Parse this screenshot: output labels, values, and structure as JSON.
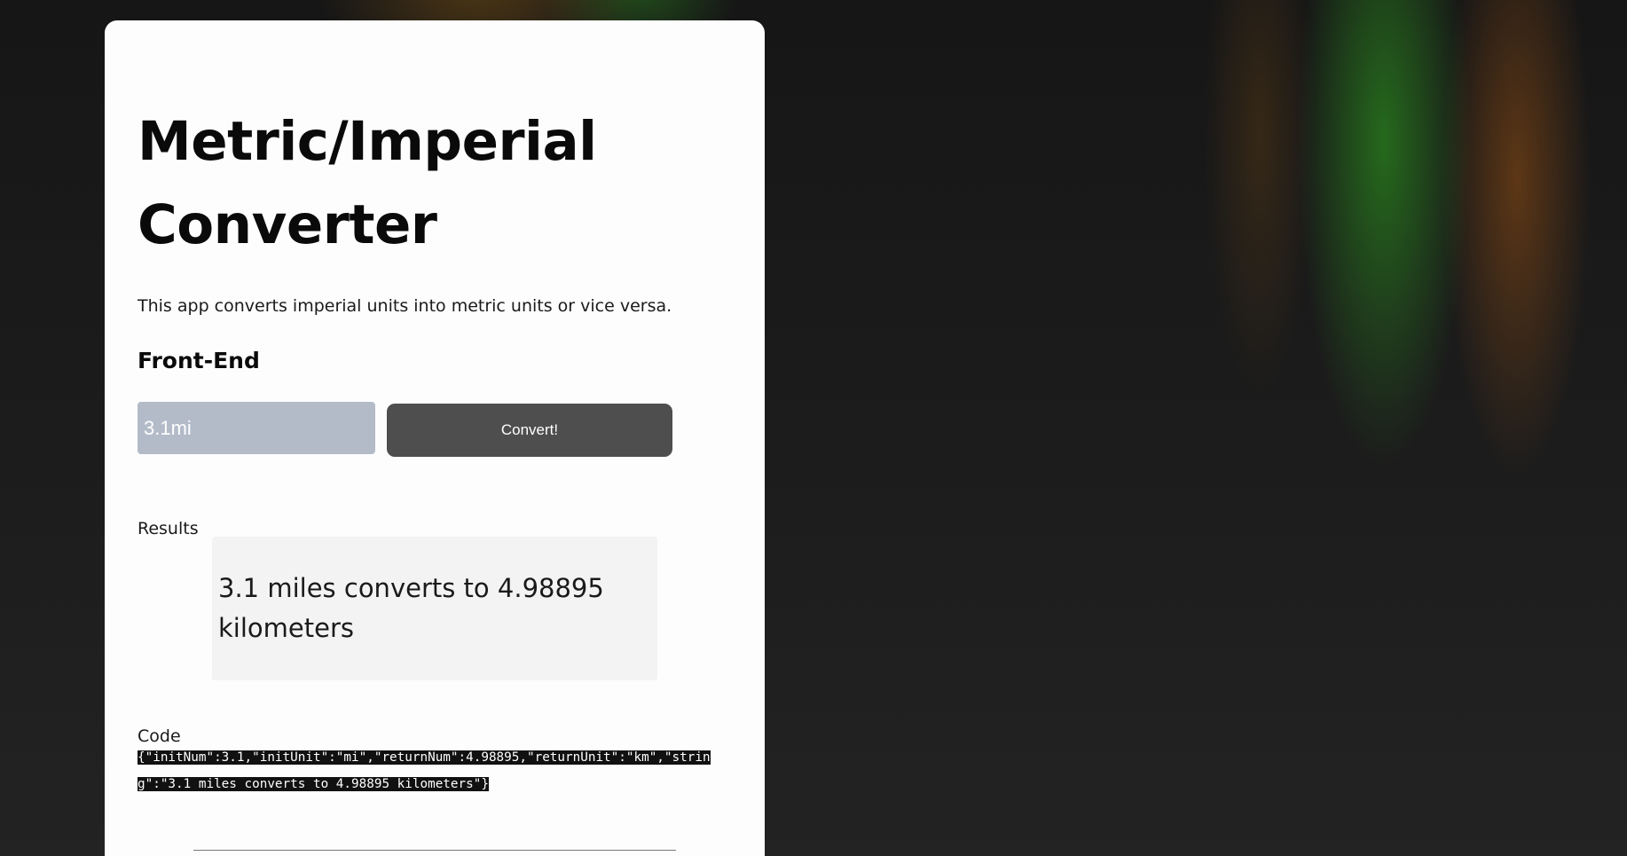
{
  "page": {
    "title": "Metric/Imperial Converter",
    "description": "This app converts imperial units into metric units or vice versa."
  },
  "frontend": {
    "heading": "Front-End",
    "input_value": "3.1mi",
    "convert_label": "Convert!"
  },
  "results": {
    "label": "Results",
    "text": "3.1 miles converts to 4.98895 kilometers"
  },
  "code": {
    "label": "Code",
    "json": "{\"initNum\":3.1,\"initUnit\":\"mi\",\"returnNum\":4.98895,\"returnUnit\":\"km\",\"string\":\"3.1 miles converts to 4.98895 kilometers\"}"
  },
  "colors": {
    "input_bg": "#b3bbc9",
    "button_bg": "#4e4e4e",
    "result_bg": "#f3f3f3",
    "code_bg": "#111111"
  }
}
